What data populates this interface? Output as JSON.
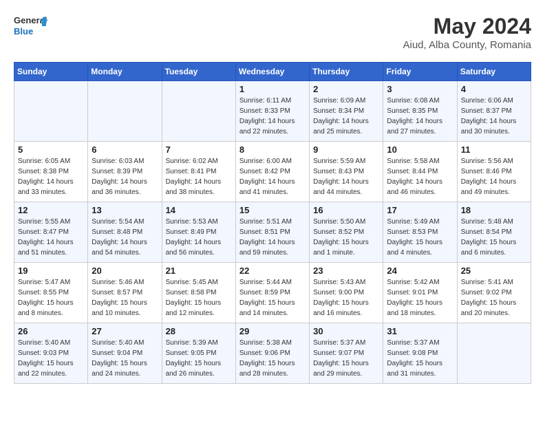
{
  "header": {
    "logo_general": "General",
    "logo_blue": "Blue",
    "month_year": "May 2024",
    "location": "Aiud, Alba County, Romania"
  },
  "weekdays": [
    "Sunday",
    "Monday",
    "Tuesday",
    "Wednesday",
    "Thursday",
    "Friday",
    "Saturday"
  ],
  "weeks": [
    [
      {
        "day": "",
        "text": ""
      },
      {
        "day": "",
        "text": ""
      },
      {
        "day": "",
        "text": ""
      },
      {
        "day": "1",
        "text": "Sunrise: 6:11 AM\nSunset: 8:33 PM\nDaylight: 14 hours\nand 22 minutes."
      },
      {
        "day": "2",
        "text": "Sunrise: 6:09 AM\nSunset: 8:34 PM\nDaylight: 14 hours\nand 25 minutes."
      },
      {
        "day": "3",
        "text": "Sunrise: 6:08 AM\nSunset: 8:35 PM\nDaylight: 14 hours\nand 27 minutes."
      },
      {
        "day": "4",
        "text": "Sunrise: 6:06 AM\nSunset: 8:37 PM\nDaylight: 14 hours\nand 30 minutes."
      }
    ],
    [
      {
        "day": "5",
        "text": "Sunrise: 6:05 AM\nSunset: 8:38 PM\nDaylight: 14 hours\nand 33 minutes."
      },
      {
        "day": "6",
        "text": "Sunrise: 6:03 AM\nSunset: 8:39 PM\nDaylight: 14 hours\nand 36 minutes."
      },
      {
        "day": "7",
        "text": "Sunrise: 6:02 AM\nSunset: 8:41 PM\nDaylight: 14 hours\nand 38 minutes."
      },
      {
        "day": "8",
        "text": "Sunrise: 6:00 AM\nSunset: 8:42 PM\nDaylight: 14 hours\nand 41 minutes."
      },
      {
        "day": "9",
        "text": "Sunrise: 5:59 AM\nSunset: 8:43 PM\nDaylight: 14 hours\nand 44 minutes."
      },
      {
        "day": "10",
        "text": "Sunrise: 5:58 AM\nSunset: 8:44 PM\nDaylight: 14 hours\nand 46 minutes."
      },
      {
        "day": "11",
        "text": "Sunrise: 5:56 AM\nSunset: 8:46 PM\nDaylight: 14 hours\nand 49 minutes."
      }
    ],
    [
      {
        "day": "12",
        "text": "Sunrise: 5:55 AM\nSunset: 8:47 PM\nDaylight: 14 hours\nand 51 minutes."
      },
      {
        "day": "13",
        "text": "Sunrise: 5:54 AM\nSunset: 8:48 PM\nDaylight: 14 hours\nand 54 minutes."
      },
      {
        "day": "14",
        "text": "Sunrise: 5:53 AM\nSunset: 8:49 PM\nDaylight: 14 hours\nand 56 minutes."
      },
      {
        "day": "15",
        "text": "Sunrise: 5:51 AM\nSunset: 8:51 PM\nDaylight: 14 hours\nand 59 minutes."
      },
      {
        "day": "16",
        "text": "Sunrise: 5:50 AM\nSunset: 8:52 PM\nDaylight: 15 hours\nand 1 minute."
      },
      {
        "day": "17",
        "text": "Sunrise: 5:49 AM\nSunset: 8:53 PM\nDaylight: 15 hours\nand 4 minutes."
      },
      {
        "day": "18",
        "text": "Sunrise: 5:48 AM\nSunset: 8:54 PM\nDaylight: 15 hours\nand 6 minutes."
      }
    ],
    [
      {
        "day": "19",
        "text": "Sunrise: 5:47 AM\nSunset: 8:55 PM\nDaylight: 15 hours\nand 8 minutes."
      },
      {
        "day": "20",
        "text": "Sunrise: 5:46 AM\nSunset: 8:57 PM\nDaylight: 15 hours\nand 10 minutes."
      },
      {
        "day": "21",
        "text": "Sunrise: 5:45 AM\nSunset: 8:58 PM\nDaylight: 15 hours\nand 12 minutes."
      },
      {
        "day": "22",
        "text": "Sunrise: 5:44 AM\nSunset: 8:59 PM\nDaylight: 15 hours\nand 14 minutes."
      },
      {
        "day": "23",
        "text": "Sunrise: 5:43 AM\nSunset: 9:00 PM\nDaylight: 15 hours\nand 16 minutes."
      },
      {
        "day": "24",
        "text": "Sunrise: 5:42 AM\nSunset: 9:01 PM\nDaylight: 15 hours\nand 18 minutes."
      },
      {
        "day": "25",
        "text": "Sunrise: 5:41 AM\nSunset: 9:02 PM\nDaylight: 15 hours\nand 20 minutes."
      }
    ],
    [
      {
        "day": "26",
        "text": "Sunrise: 5:40 AM\nSunset: 9:03 PM\nDaylight: 15 hours\nand 22 minutes."
      },
      {
        "day": "27",
        "text": "Sunrise: 5:40 AM\nSunset: 9:04 PM\nDaylight: 15 hours\nand 24 minutes."
      },
      {
        "day": "28",
        "text": "Sunrise: 5:39 AM\nSunset: 9:05 PM\nDaylight: 15 hours\nand 26 minutes."
      },
      {
        "day": "29",
        "text": "Sunrise: 5:38 AM\nSunset: 9:06 PM\nDaylight: 15 hours\nand 28 minutes."
      },
      {
        "day": "30",
        "text": "Sunrise: 5:37 AM\nSunset: 9:07 PM\nDaylight: 15 hours\nand 29 minutes."
      },
      {
        "day": "31",
        "text": "Sunrise: 5:37 AM\nSunset: 9:08 PM\nDaylight: 15 hours\nand 31 minutes."
      },
      {
        "day": "",
        "text": ""
      }
    ]
  ]
}
